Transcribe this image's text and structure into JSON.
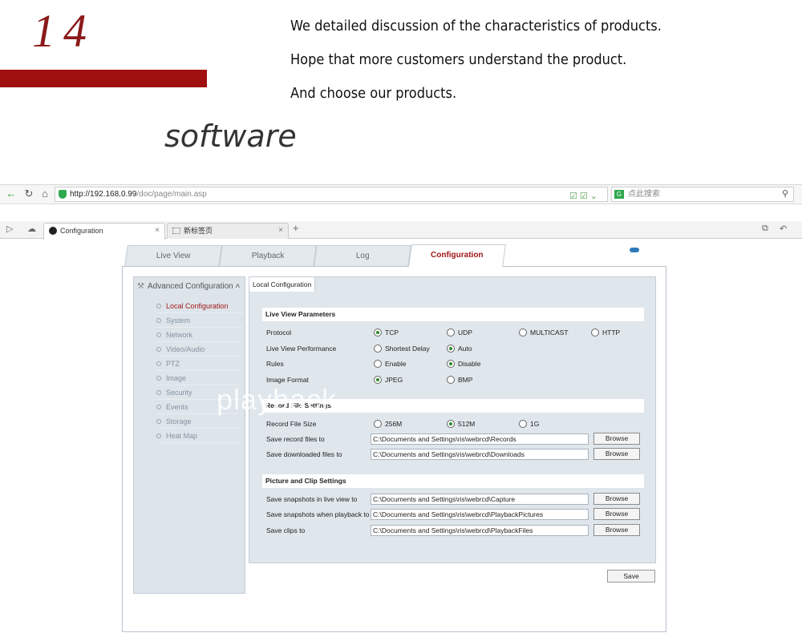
{
  "banner": {
    "number": "14",
    "lines": [
      "We detailed discussion of the characteristics of products.",
      "Hope that more customers understand the product.",
      "And choose our products."
    ],
    "subtitle": "software"
  },
  "browser": {
    "url_host": "http://192.168.0.99",
    "url_path": "/doc/page/main.asp",
    "search_placeholder": "点此搜索",
    "tabs": [
      {
        "label": "Configuration"
      },
      {
        "label": "新标签页"
      }
    ],
    "new_tab_icon": "plus-icon"
  },
  "app": {
    "main_tabs": [
      "Live View",
      "Playback",
      "Log",
      "Configuration"
    ],
    "active_main_tab": "Configuration",
    "sidebar": {
      "title": "Advanced Configuration",
      "items": [
        "Local Configuration",
        "System",
        "Network",
        "Video/Audio",
        "PTZ",
        "Image",
        "Security",
        "Events",
        "Storage",
        "Heat Map"
      ]
    },
    "sub_tab": "Local Configuration",
    "live_view": {
      "title": "Live View Parameters",
      "protocol": {
        "label": "Protocol",
        "options": [
          "TCP",
          "UDP",
          "MULTICAST",
          "HTTP"
        ],
        "selected": "TCP"
      },
      "performance": {
        "label": "Live View Performance",
        "options": [
          "Shortest Delay",
          "Auto"
        ],
        "selected": "Auto"
      },
      "rules": {
        "label": "Rules",
        "options": [
          "Enable",
          "Disable"
        ],
        "selected": "Disable"
      },
      "image_format": {
        "label": "Image Format",
        "options": [
          "JPEG",
          "BMP"
        ],
        "selected": "JPEG"
      }
    },
    "record": {
      "title": "Record File Settings",
      "file_size": {
        "label": "Record File Size",
        "options": [
          "256M",
          "512M",
          "1G"
        ],
        "selected": "512M"
      },
      "save_record": {
        "label": "Save record files to",
        "value": "C:\\Documents and Settings\\ris\\webrcd\\Records"
      },
      "save_download": {
        "label": "Save downloaded files to",
        "value": "C:\\Documents and Settings\\ris\\webrcd\\Downloads"
      }
    },
    "picture": {
      "title": "Picture and Clip Settings",
      "snap_live": {
        "label": "Save snapshots in live view to",
        "value": "C:\\Documents and Settings\\ris\\webrcd\\Capture"
      },
      "snap_playback": {
        "label": "Save snapshots when playback to",
        "value": "C:\\Documents and Settings\\ris\\webrcd\\PlaybackPictures"
      },
      "clips": {
        "label": "Save clips to",
        "value": "C:\\Documents and Settings\\ris\\webrcd\\PlaybackFiles"
      }
    },
    "browse_label": "Browse",
    "save_label": "Save"
  },
  "watermark": "playback"
}
